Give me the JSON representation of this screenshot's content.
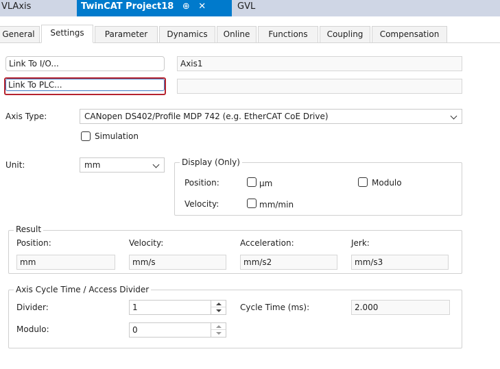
{
  "doc_tabs": [
    {
      "label": "VLAxis"
    },
    {
      "label": "TwinCAT Project18",
      "pin_icon": "⊕",
      "close_icon": "✕"
    },
    {
      "label": "GVL"
    }
  ],
  "settings_tabs": [
    "General",
    "Settings",
    "Parameter",
    "Dynamics",
    "Online",
    "Functions",
    "Coupling",
    "Compensation"
  ],
  "link_io_label": "Link To I/O...",
  "link_io_value": "Axis1",
  "link_plc_label": "Link To PLC...",
  "link_plc_value": "",
  "axis_type": {
    "label": "Axis Type:",
    "value": "CANopen DS402/Profile MDP 742 (e.g. EtherCAT CoE Drive)",
    "simulation_label": "Simulation"
  },
  "unit": {
    "label": "Unit:",
    "value": "mm"
  },
  "display": {
    "title": "Display (Only)",
    "position_label": "Position:",
    "um_label": "μm",
    "modulo_label": "Modulo",
    "velocity_label": "Velocity:",
    "mm_min_label": "mm/min"
  },
  "result": {
    "title": "Result",
    "position_label": "Position:",
    "position_value": "mm",
    "velocity_label": "Velocity:",
    "velocity_value": "mm/s",
    "acceleration_label": "Acceleration:",
    "acceleration_value": "mm/s2",
    "jerk_label": "Jerk:",
    "jerk_value": "mm/s3"
  },
  "cycle": {
    "title": "Axis Cycle Time / Access Divider",
    "divider_label": "Divider:",
    "divider_value": "1",
    "cycle_time_label": "Cycle Time (ms):",
    "cycle_time_value": "2.000",
    "modulo_label": "Modulo:",
    "modulo_value": "0"
  },
  "colors": {
    "active_tab": "#007acc",
    "focus_border": "#b5232e",
    "tab_strip": "#cfd6e5"
  }
}
